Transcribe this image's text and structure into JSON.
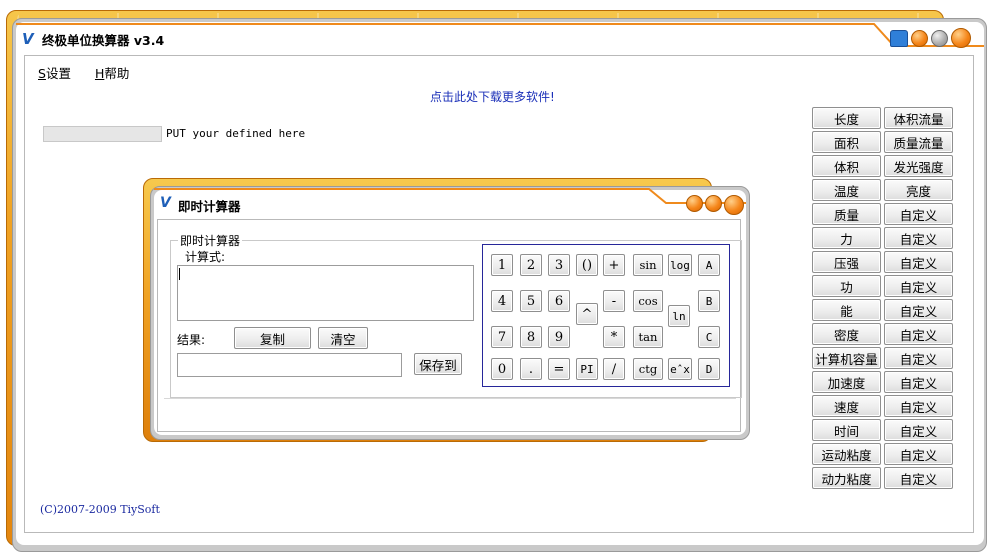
{
  "app": {
    "title": "终极单位换算器 v3.4",
    "logo": "V"
  },
  "menu": [
    {
      "key": "S",
      "label": "设置"
    },
    {
      "key": "H",
      "label": "帮助"
    }
  ],
  "download_link": "点击此处下载更多软件!",
  "custom_input": {
    "value": "",
    "label": "PUT your defined here"
  },
  "copyright": "(C)2007-2009 TiySoft",
  "unit_buttons": {
    "col1": [
      "长度",
      "面积",
      "体积",
      "温度",
      "质量",
      "力",
      "压强",
      "功",
      "能",
      "密度",
      "计算机容量",
      "加速度",
      "速度",
      "时间",
      "运动粘度",
      "动力粘度"
    ],
    "col2": [
      "体积流量",
      "质量流量",
      "发光强度",
      "亮度",
      "自定义",
      "自定义",
      "自定义",
      "自定义",
      "自定义",
      "自定义",
      "自定义",
      "自定义",
      "自定义",
      "自定义",
      "自定义",
      "自定义"
    ]
  },
  "calc": {
    "title": "即时计算器",
    "logo": "V",
    "group_label": "即时计算器",
    "formula_label": "计算式:",
    "formula_value": "",
    "result_label": "结果:",
    "result_value": "",
    "copy_button": "复制",
    "clear_button": "清空",
    "save_button": "保存到",
    "keys": {
      "k1": "1",
      "k2": "2",
      "k3": "3",
      "paren": "()",
      "plus": "+",
      "sin": "sin",
      "log": "log",
      "A": "A",
      "k4": "4",
      "k5": "5",
      "k6": "6",
      "pow": "^",
      "minus": "-",
      "cos": "cos",
      "ln": "ln",
      "B": "B",
      "k7": "7",
      "k8": "8",
      "k9": "9",
      "mul": "*",
      "tan": "tan",
      "C": "C",
      "k0": "0",
      "dot": ".",
      "eq": "=",
      "pi": "PI",
      "div": "/",
      "ctg": "ctg",
      "exp": "eˆx",
      "D": "D"
    }
  }
}
